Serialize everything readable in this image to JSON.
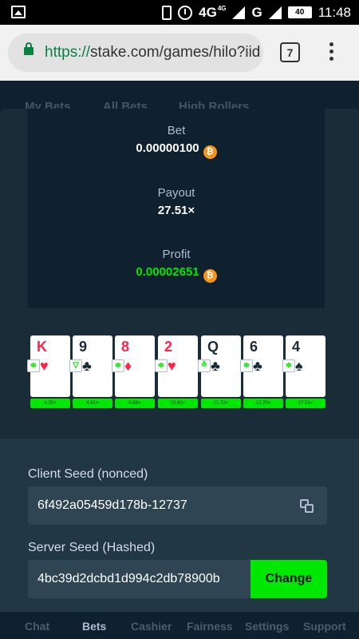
{
  "status_bar": {
    "network": "4G",
    "network_sub": "4G",
    "signal": "G",
    "battery": "40",
    "time": "11:48"
  },
  "browser": {
    "url_scheme": "https://",
    "url_rest": "stake.com/games/hilo?iid",
    "tab_count": "7"
  },
  "background_tabs": [
    "My Bets",
    "All Bets",
    "High Rollers"
  ],
  "stats": {
    "bet_label": "Bet",
    "bet_value": "0.00000100",
    "payout_label": "Payout",
    "payout_value": "27.51×",
    "profit_label": "Profit",
    "profit_value": "0.00002651",
    "currency_glyph": "₿"
  },
  "cards": [
    {
      "rank": "K",
      "suit": "♥",
      "color": "red",
      "guess": "≑",
      "multiplier": "4.25×"
    },
    {
      "rank": "9",
      "suit": "♣",
      "color": "black",
      "guess": "▽",
      "multiplier": "4.61×"
    },
    {
      "rank": "8",
      "suit": "♦",
      "color": "red",
      "guess": "≑",
      "multiplier": "6.66×"
    },
    {
      "rank": "2",
      "suit": "♥",
      "color": "red",
      "guess": "≑",
      "multiplier": "10.82×"
    },
    {
      "rank": "Q",
      "suit": "♣",
      "color": "black",
      "guess": "≙",
      "multiplier": "11.72×"
    },
    {
      "rank": "6",
      "suit": "♣",
      "color": "black",
      "guess": "≑",
      "multiplier": "12.70×"
    },
    {
      "rank": "4",
      "suit": "♠",
      "color": "black",
      "guess": "≑",
      "multiplier": "27.51×"
    }
  ],
  "client_seed": {
    "label": "Client Seed (nonced)",
    "value": "6f492a05459d178b-12737"
  },
  "server_seed": {
    "label": "Server Seed (Hashed)",
    "value": "4bc39d2dcbd1d994c2db78900b",
    "button": "Change"
  },
  "bottom_nav": [
    "Chat",
    "Bets",
    "Cashier",
    "Fairness",
    "Settings",
    "Support"
  ],
  "colors": {
    "accent_green": "#00e701",
    "panel_dark": "#0f212e",
    "panel": "#1a2c38",
    "card_red": "#fe2247",
    "bitcoin": "#f7931a"
  }
}
